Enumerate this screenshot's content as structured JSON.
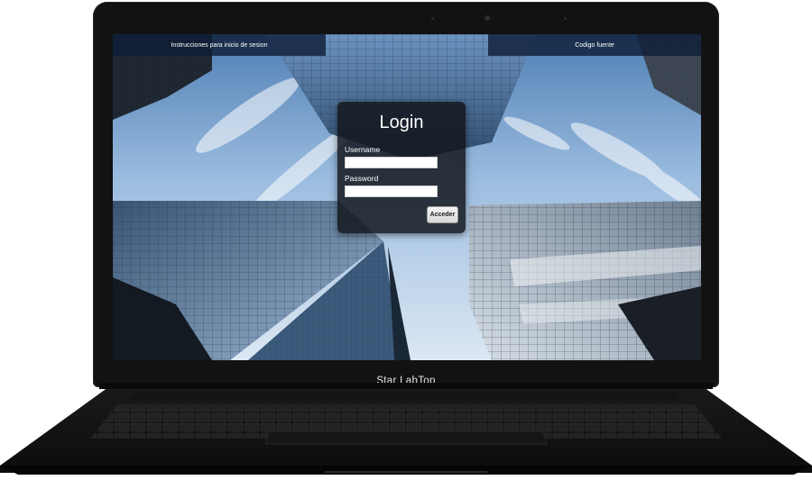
{
  "device": {
    "brand_label": "Star LabTop"
  },
  "nav": {
    "instrucciones_label": "Instrucciones para inicio de sesion",
    "codigo_label": "Codigo fuente"
  },
  "login": {
    "title": "Login",
    "username_label": "Username",
    "username_value": "",
    "password_label": "Password",
    "password_value": "",
    "submit_label": "Acceder"
  },
  "wallpaper": {
    "description_icon": "skyscrapers-looking-up-photo"
  },
  "colors": {
    "bezel": "#121212",
    "nav_bg": "#0f1f38",
    "card_bg": "#12161c",
    "sky": "#8fb2d9"
  }
}
